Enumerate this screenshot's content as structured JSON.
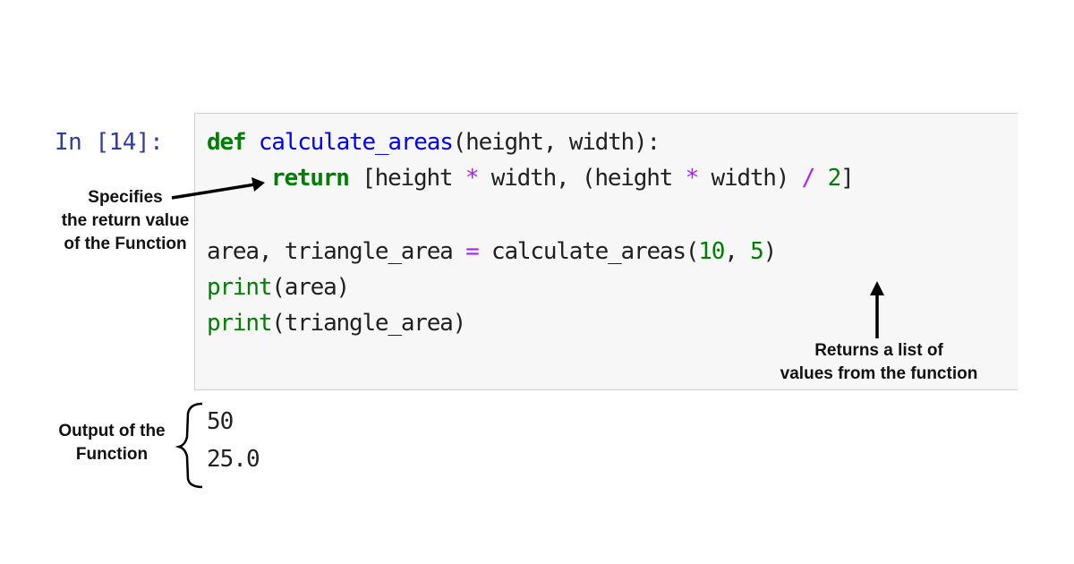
{
  "cell": {
    "prompt": "In [14]:",
    "code": {
      "line1": {
        "kw": "def",
        "name": "calculate_areas",
        "rest": "(height, width):"
      },
      "line2": {
        "kw": "return",
        "p1": " [height ",
        "op1": "*",
        "p2": " width, (height ",
        "op2": "*",
        "p3": " width) ",
        "op3": "/",
        "p4": " ",
        "num": "2",
        "p5": "]"
      },
      "line3": {
        "p1": "area, triangle_area ",
        "op": "=",
        "p2": " calculate_areas(",
        "n1": "10",
        "p3": ", ",
        "n2": "5",
        "p4": ")"
      },
      "line4": {
        "fn": "print",
        "rest": "(area)"
      },
      "line5": {
        "fn": "print",
        "rest": "(triangle_area)"
      }
    }
  },
  "output": {
    "lines": [
      "50",
      "25.0"
    ]
  },
  "annotations": {
    "return_value": [
      "Specifies",
      "the return value",
      "of the Function"
    ],
    "returns_list": [
      "Returns a list of",
      "values from the function"
    ],
    "output_label": [
      "Output of the",
      "Function"
    ]
  }
}
